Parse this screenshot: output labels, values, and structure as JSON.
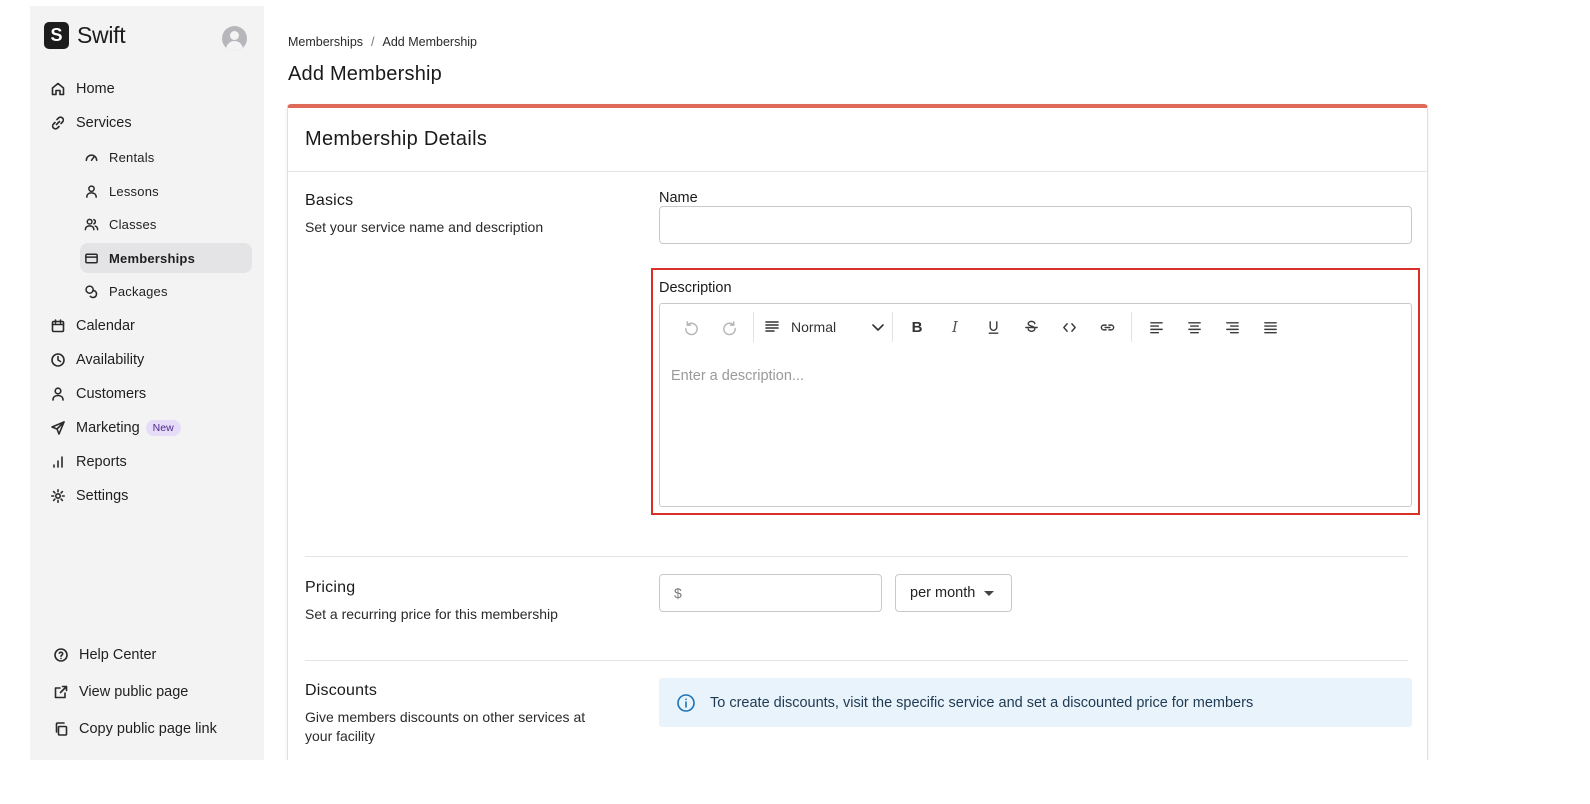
{
  "app": {
    "name": "Swift",
    "logo_letter": "S"
  },
  "sidebar": {
    "items": [
      {
        "label": "Home",
        "icon": "home-icon"
      },
      {
        "label": "Services",
        "icon": "link-icon"
      },
      {
        "label": "Calendar",
        "icon": "calendar-icon"
      },
      {
        "label": "Availability",
        "icon": "clock-icon"
      },
      {
        "label": "Customers",
        "icon": "user-icon"
      },
      {
        "label": "Marketing",
        "icon": "send-icon",
        "badge": "New"
      },
      {
        "label": "Reports",
        "icon": "bar-chart-icon"
      },
      {
        "label": "Settings",
        "icon": "gear-icon"
      }
    ],
    "services_sub": [
      {
        "label": "Rentals",
        "icon": "gauge-icon"
      },
      {
        "label": "Lessons",
        "icon": "user-icon"
      },
      {
        "label": "Classes",
        "icon": "users-icon"
      },
      {
        "label": "Memberships",
        "icon": "card-icon",
        "active": true
      },
      {
        "label": "Packages",
        "icon": "coins-icon"
      }
    ],
    "footer": [
      {
        "label": "Help Center",
        "icon": "help-circle-icon"
      },
      {
        "label": "View public page",
        "icon": "external-link-icon"
      },
      {
        "label": "Copy public page link",
        "icon": "copy-icon"
      }
    ]
  },
  "breadcrumb": {
    "parent": "Memberships",
    "separator": "/",
    "current": "Add Membership"
  },
  "page": {
    "title": "Add Membership"
  },
  "card": {
    "title": "Membership Details",
    "basics": {
      "title": "Basics",
      "description": "Set your service name and description",
      "name_label": "Name",
      "name_value": "",
      "description_label": "Description",
      "description_placeholder": "Enter a description...",
      "block_type": "Normal"
    },
    "pricing": {
      "title": "Pricing",
      "description": "Set a recurring price for this membership",
      "currency_symbol": "$",
      "price_value": "",
      "period": "per month"
    },
    "discounts": {
      "title": "Discounts",
      "description": "Give members discounts on other services at your facility",
      "info": "To create discounts, visit the specific service and set a discounted price for members"
    }
  },
  "colors": {
    "accent_top_border": "#e06a5a",
    "highlight": "#d9302a",
    "info_bg": "#e8f3fb",
    "badge_bg": "#e7dcf8"
  }
}
